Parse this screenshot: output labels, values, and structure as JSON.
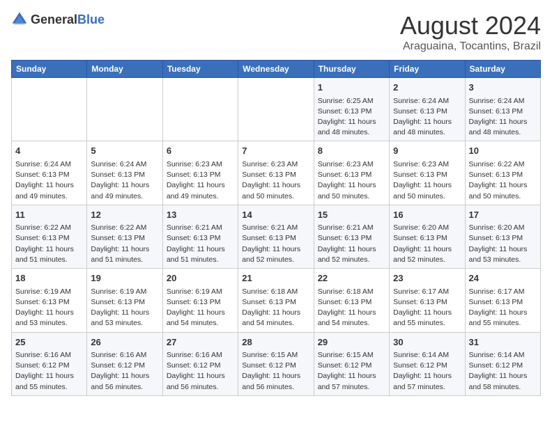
{
  "logo": {
    "general": "General",
    "blue": "Blue"
  },
  "title": "August 2024",
  "subtitle": "Araguaina, Tocantins, Brazil",
  "weekdays": [
    "Sunday",
    "Monday",
    "Tuesday",
    "Wednesday",
    "Thursday",
    "Friday",
    "Saturday"
  ],
  "weeks": [
    [
      {
        "day": "",
        "content": ""
      },
      {
        "day": "",
        "content": ""
      },
      {
        "day": "",
        "content": ""
      },
      {
        "day": "",
        "content": ""
      },
      {
        "day": "1",
        "content": "Sunrise: 6:25 AM\nSunset: 6:13 PM\nDaylight: 11 hours\nand 48 minutes."
      },
      {
        "day": "2",
        "content": "Sunrise: 6:24 AM\nSunset: 6:13 PM\nDaylight: 11 hours\nand 48 minutes."
      },
      {
        "day": "3",
        "content": "Sunrise: 6:24 AM\nSunset: 6:13 PM\nDaylight: 11 hours\nand 48 minutes."
      }
    ],
    [
      {
        "day": "4",
        "content": "Sunrise: 6:24 AM\nSunset: 6:13 PM\nDaylight: 11 hours\nand 49 minutes."
      },
      {
        "day": "5",
        "content": "Sunrise: 6:24 AM\nSunset: 6:13 PM\nDaylight: 11 hours\nand 49 minutes."
      },
      {
        "day": "6",
        "content": "Sunrise: 6:23 AM\nSunset: 6:13 PM\nDaylight: 11 hours\nand 49 minutes."
      },
      {
        "day": "7",
        "content": "Sunrise: 6:23 AM\nSunset: 6:13 PM\nDaylight: 11 hours\nand 50 minutes."
      },
      {
        "day": "8",
        "content": "Sunrise: 6:23 AM\nSunset: 6:13 PM\nDaylight: 11 hours\nand 50 minutes."
      },
      {
        "day": "9",
        "content": "Sunrise: 6:23 AM\nSunset: 6:13 PM\nDaylight: 11 hours\nand 50 minutes."
      },
      {
        "day": "10",
        "content": "Sunrise: 6:22 AM\nSunset: 6:13 PM\nDaylight: 11 hours\nand 50 minutes."
      }
    ],
    [
      {
        "day": "11",
        "content": "Sunrise: 6:22 AM\nSunset: 6:13 PM\nDaylight: 11 hours\nand 51 minutes."
      },
      {
        "day": "12",
        "content": "Sunrise: 6:22 AM\nSunset: 6:13 PM\nDaylight: 11 hours\nand 51 minutes."
      },
      {
        "day": "13",
        "content": "Sunrise: 6:21 AM\nSunset: 6:13 PM\nDaylight: 11 hours\nand 51 minutes."
      },
      {
        "day": "14",
        "content": "Sunrise: 6:21 AM\nSunset: 6:13 PM\nDaylight: 11 hours\nand 52 minutes."
      },
      {
        "day": "15",
        "content": "Sunrise: 6:21 AM\nSunset: 6:13 PM\nDaylight: 11 hours\nand 52 minutes."
      },
      {
        "day": "16",
        "content": "Sunrise: 6:20 AM\nSunset: 6:13 PM\nDaylight: 11 hours\nand 52 minutes."
      },
      {
        "day": "17",
        "content": "Sunrise: 6:20 AM\nSunset: 6:13 PM\nDaylight: 11 hours\nand 53 minutes."
      }
    ],
    [
      {
        "day": "18",
        "content": "Sunrise: 6:19 AM\nSunset: 6:13 PM\nDaylight: 11 hours\nand 53 minutes."
      },
      {
        "day": "19",
        "content": "Sunrise: 6:19 AM\nSunset: 6:13 PM\nDaylight: 11 hours\nand 53 minutes."
      },
      {
        "day": "20",
        "content": "Sunrise: 6:19 AM\nSunset: 6:13 PM\nDaylight: 11 hours\nand 54 minutes."
      },
      {
        "day": "21",
        "content": "Sunrise: 6:18 AM\nSunset: 6:13 PM\nDaylight: 11 hours\nand 54 minutes."
      },
      {
        "day": "22",
        "content": "Sunrise: 6:18 AM\nSunset: 6:13 PM\nDaylight: 11 hours\nand 54 minutes."
      },
      {
        "day": "23",
        "content": "Sunrise: 6:17 AM\nSunset: 6:13 PM\nDaylight: 11 hours\nand 55 minutes."
      },
      {
        "day": "24",
        "content": "Sunrise: 6:17 AM\nSunset: 6:13 PM\nDaylight: 11 hours\nand 55 minutes."
      }
    ],
    [
      {
        "day": "25",
        "content": "Sunrise: 6:16 AM\nSunset: 6:12 PM\nDaylight: 11 hours\nand 55 minutes."
      },
      {
        "day": "26",
        "content": "Sunrise: 6:16 AM\nSunset: 6:12 PM\nDaylight: 11 hours\nand 56 minutes."
      },
      {
        "day": "27",
        "content": "Sunrise: 6:16 AM\nSunset: 6:12 PM\nDaylight: 11 hours\nand 56 minutes."
      },
      {
        "day": "28",
        "content": "Sunrise: 6:15 AM\nSunset: 6:12 PM\nDaylight: 11 hours\nand 56 minutes."
      },
      {
        "day": "29",
        "content": "Sunrise: 6:15 AM\nSunset: 6:12 PM\nDaylight: 11 hours\nand 57 minutes."
      },
      {
        "day": "30",
        "content": "Sunrise: 6:14 AM\nSunset: 6:12 PM\nDaylight: 11 hours\nand 57 minutes."
      },
      {
        "day": "31",
        "content": "Sunrise: 6:14 AM\nSunset: 6:12 PM\nDaylight: 11 hours\nand 58 minutes."
      }
    ]
  ]
}
